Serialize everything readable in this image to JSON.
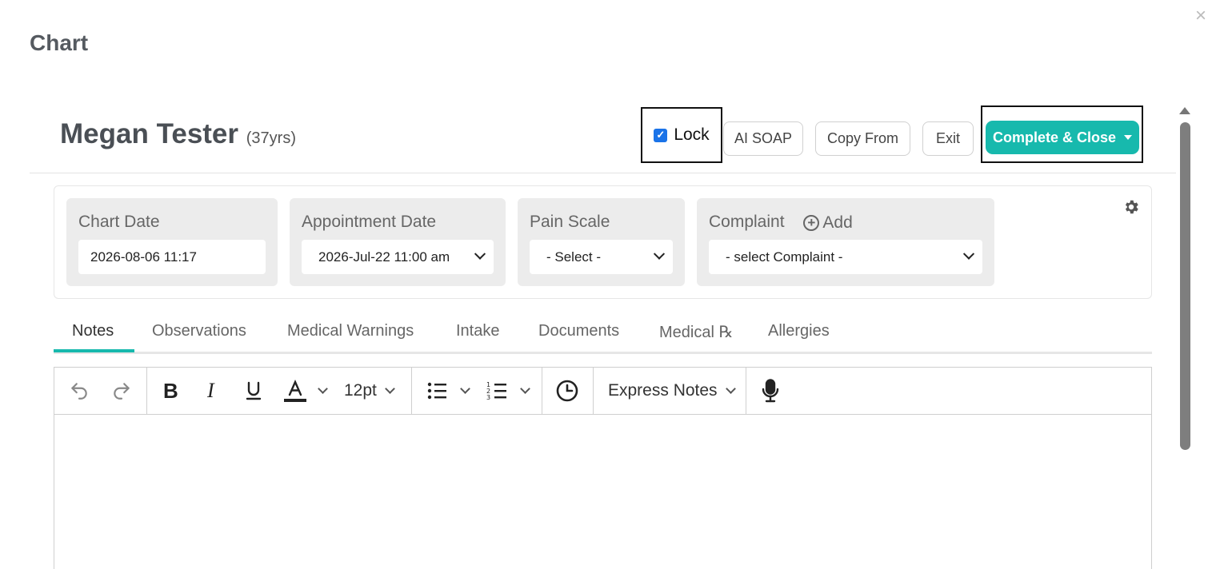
{
  "modal": {
    "title": "Chart",
    "close_glyph": "×"
  },
  "patient": {
    "name": "Megan Tester",
    "age": "(37yrs)"
  },
  "header_actions": {
    "lock_label": "Lock",
    "lock_checked": true,
    "ai_soap_label": "AI SOAP",
    "copy_from_label": "Copy From",
    "exit_label": "Exit",
    "complete_label": "Complete & Close"
  },
  "fields": {
    "chart_date": {
      "label": "Chart Date",
      "value": "2026-08-06 11:17"
    },
    "appointment_date": {
      "label": "Appointment Date",
      "value": "2026-Jul-22 11:00 am"
    },
    "pain_scale": {
      "label": "Pain Scale",
      "value": "- Select -"
    },
    "complaint": {
      "label": "Complaint",
      "add_label": "Add",
      "value": "- select Complaint -"
    }
  },
  "tabs": [
    {
      "label": "Notes",
      "active": true
    },
    {
      "label": "Observations",
      "active": false
    },
    {
      "label": "Medical Warnings",
      "active": false
    },
    {
      "label": "Intake",
      "active": false
    },
    {
      "label": "Documents",
      "active": false
    },
    {
      "label": "Medical ℞",
      "active": false
    },
    {
      "label": "Allergies",
      "active": false
    }
  ],
  "toolbar": {
    "font_size": "12pt",
    "express_notes_label": "Express Notes",
    "icons": [
      "undo-icon",
      "redo-icon",
      "bold-icon",
      "italic-icon",
      "underline-icon",
      "font-color-icon",
      "bullet-list-icon",
      "numbered-list-icon",
      "clock-icon",
      "microphone-icon"
    ]
  },
  "colors": {
    "accent": "#17b9ad",
    "checkbox": "#1a73e8"
  }
}
